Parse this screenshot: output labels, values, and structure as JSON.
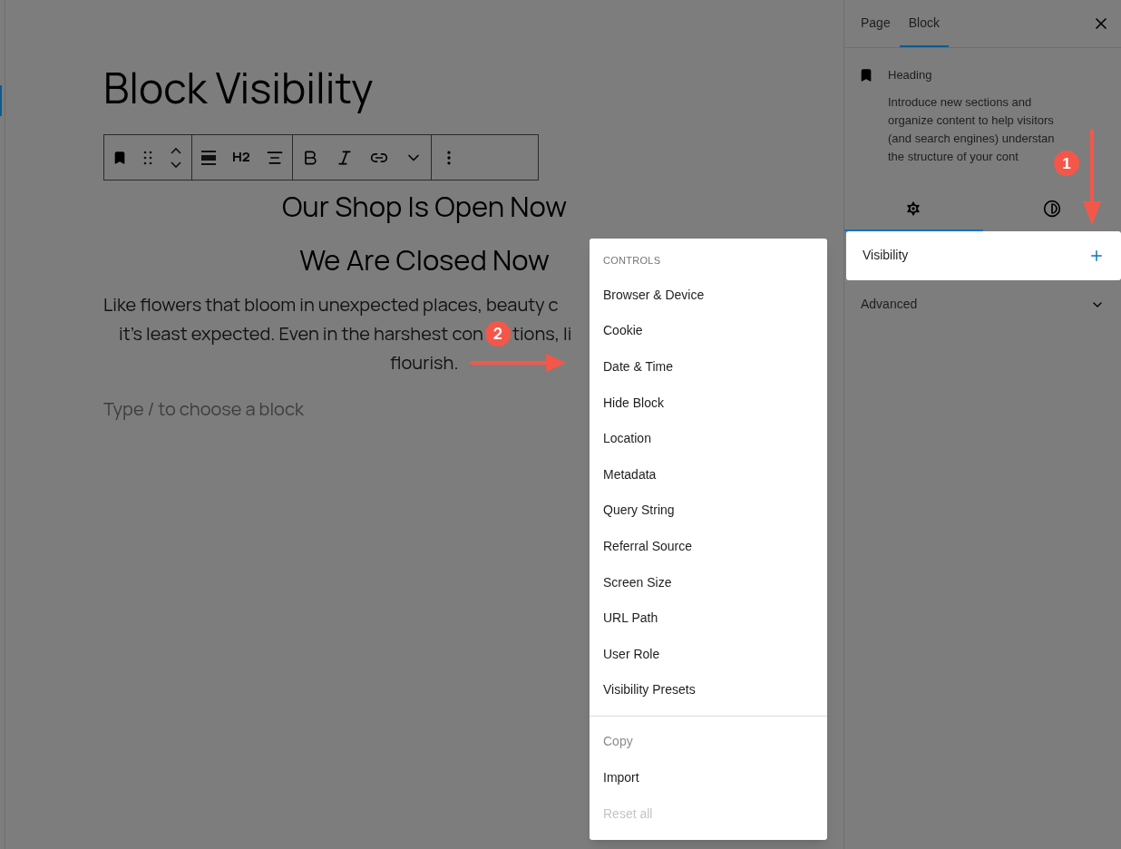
{
  "editor": {
    "title": "Block Visibility",
    "toolbar_label": "H2",
    "headings": [
      "Our Shop Is Open Now",
      "We Are Closed Now"
    ],
    "paragraph_lines": [
      [
        "Like flowers that bloom in unexpected places, beauty c"
      ],
      [
        "it's least expected. Even in the harshest con",
        "tions, li"
      ],
      [
        "flourish."
      ]
    ],
    "placeholder": "Type / to choose a block"
  },
  "sidebar": {
    "tabs": [
      {
        "label": "Page",
        "selected": false
      },
      {
        "label": "Block",
        "selected": true
      }
    ],
    "block": {
      "name": "Heading",
      "description_lines": [
        "Introduce new sections and",
        "organize content to help visitors",
        "(and search engines) understan",
        "the structure of your cont"
      ]
    },
    "inspector_tabs": [
      {
        "selected": true
      },
      {
        "selected": false
      }
    ],
    "panels": [
      {
        "label": "Visibility",
        "kind": "add",
        "open": true
      },
      {
        "label": "Advanced",
        "kind": "expand",
        "open": false
      }
    ]
  },
  "menu": {
    "heading": "CONTROLS",
    "items": [
      {
        "label": "Browser & Device",
        "disabled": false
      },
      {
        "label": "Cookie",
        "disabled": false
      },
      {
        "label": "Date & Time",
        "disabled": false
      },
      {
        "label": "Hide Block",
        "disabled": false
      },
      {
        "label": "Location",
        "disabled": false
      },
      {
        "label": "Metadata",
        "disabled": false
      },
      {
        "label": "Query String",
        "disabled": false
      },
      {
        "label": "Referral Source",
        "disabled": false
      },
      {
        "label": "Screen Size",
        "disabled": false
      },
      {
        "label": "URL Path",
        "disabled": false
      },
      {
        "label": "User Role",
        "disabled": false
      },
      {
        "label": "Visibility Presets",
        "disabled": false
      }
    ],
    "actions": [
      {
        "label": "Copy",
        "disabled": true
      },
      {
        "label": "Import",
        "disabled": false
      },
      {
        "label": "Reset all",
        "disabled": true
      }
    ]
  },
  "annotations": [
    "1",
    "2"
  ]
}
